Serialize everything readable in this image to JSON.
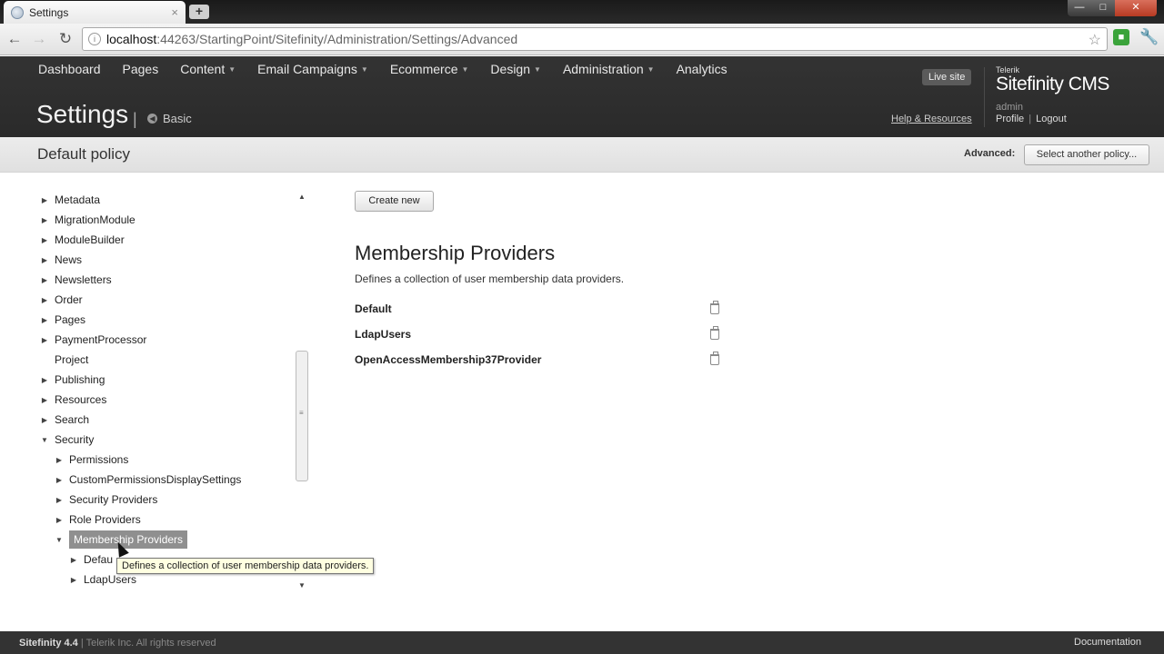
{
  "browser": {
    "tab_title": "Settings",
    "tab_close": "×",
    "new_tab": "+",
    "url_host": "localhost",
    "url_rest": ":44263/StartingPoint/Sitefinity/Administration/Settings/Advanced"
  },
  "nav": {
    "items": [
      {
        "label": "Dashboard",
        "dropdown": false
      },
      {
        "label": "Pages",
        "dropdown": false
      },
      {
        "label": "Content",
        "dropdown": true
      },
      {
        "label": "Email Campaigns",
        "dropdown": true
      },
      {
        "label": "Ecommerce",
        "dropdown": true
      },
      {
        "label": "Design",
        "dropdown": true
      },
      {
        "label": "Administration",
        "dropdown": true
      },
      {
        "label": "Analytics",
        "dropdown": false
      }
    ]
  },
  "header": {
    "title": "Settings",
    "separator": "|",
    "basic_link": "Basic",
    "live_site": "Live site",
    "brand_small": "Telerik",
    "brand": "Sitefinity CMS",
    "username": "admin",
    "help": "Help & Resources",
    "profile": "Profile",
    "profile_sep": "|",
    "logout": "Logout"
  },
  "subheader": {
    "policy_title": "Default policy",
    "advanced_label": "Advanced:",
    "select_policy": "Select another policy..."
  },
  "tree": [
    {
      "label": "Metadata",
      "state": "collapsed",
      "level": 0
    },
    {
      "label": "MigrationModule",
      "state": "collapsed",
      "level": 0
    },
    {
      "label": "ModuleBuilder",
      "state": "collapsed",
      "level": 0
    },
    {
      "label": "News",
      "state": "collapsed",
      "level": 0
    },
    {
      "label": "Newsletters",
      "state": "collapsed",
      "level": 0
    },
    {
      "label": "Order",
      "state": "collapsed",
      "level": 0
    },
    {
      "label": "Pages",
      "state": "collapsed",
      "level": 0
    },
    {
      "label": "PaymentProcessor",
      "state": "collapsed",
      "level": 0
    },
    {
      "label": "Project",
      "state": "leaf",
      "level": 0
    },
    {
      "label": "Publishing",
      "state": "collapsed",
      "level": 0
    },
    {
      "label": "Resources",
      "state": "collapsed",
      "level": 0
    },
    {
      "label": "Search",
      "state": "collapsed",
      "level": 0
    },
    {
      "label": "Security",
      "state": "expanded",
      "level": 0
    },
    {
      "label": "Permissions",
      "state": "collapsed",
      "level": 1
    },
    {
      "label": "CustomPermissionsDisplaySettings",
      "state": "collapsed",
      "level": 1
    },
    {
      "label": "Security Providers",
      "state": "collapsed",
      "level": 1
    },
    {
      "label": "Role Providers",
      "state": "collapsed",
      "level": 1
    },
    {
      "label": "Membership Providers",
      "state": "expanded",
      "level": 1,
      "selected": true
    },
    {
      "label": "Defau",
      "state": "collapsed",
      "level": 2
    },
    {
      "label": "LdapUsers",
      "state": "collapsed",
      "level": 2
    }
  ],
  "tooltip": "Defines a collection of user membership data providers.",
  "main": {
    "create_new": "Create new",
    "title": "Membership Providers",
    "description": "Defines a collection of user membership data providers.",
    "providers": [
      "Default",
      "LdapUsers",
      "OpenAccessMembership37Provider"
    ]
  },
  "footer": {
    "version": "Sitefinity 4.4",
    "copyright": "| Telerik Inc. All rights reserved",
    "documentation": "Documentation"
  }
}
